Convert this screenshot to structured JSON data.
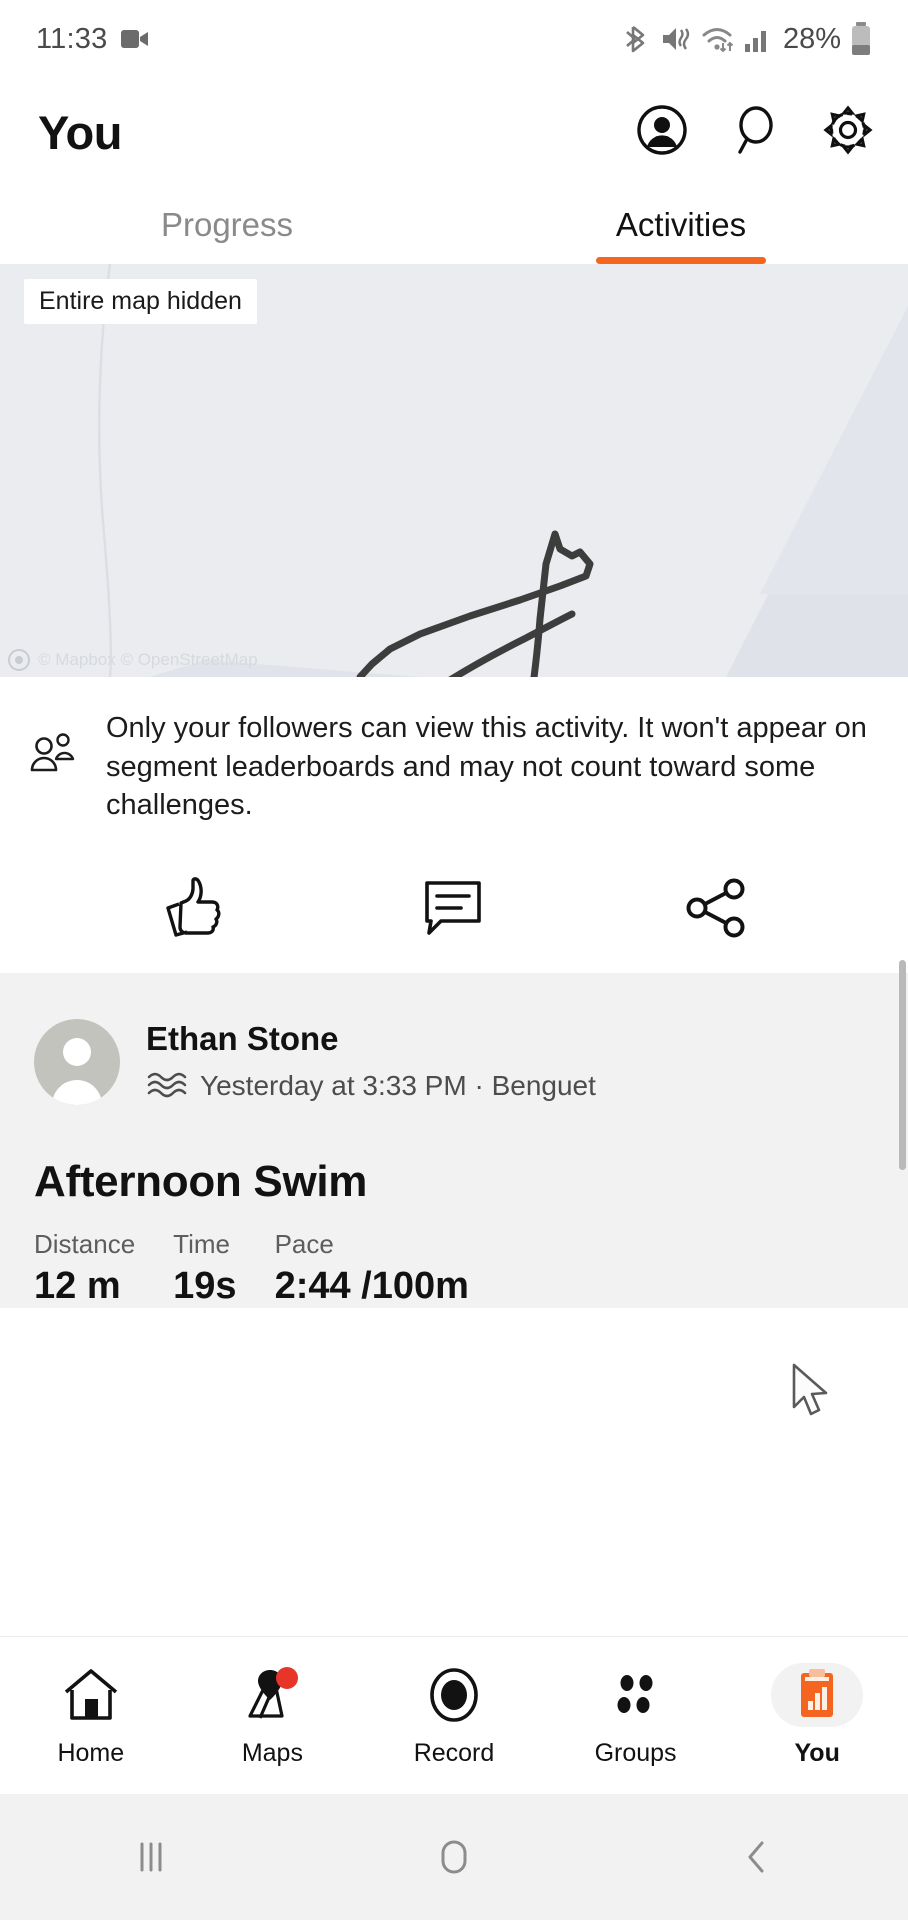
{
  "status_bar": {
    "time": "11:33",
    "battery_percent": "28%",
    "icons": [
      "video-recording-icon",
      "bluetooth-icon",
      "mute-vibrate-icon",
      "wifi-icon",
      "cellular-signal-icon",
      "battery-icon"
    ]
  },
  "header": {
    "title": "You",
    "actions": [
      {
        "name": "account-icon",
        "label": "Account"
      },
      {
        "name": "search-icon",
        "label": "Search"
      },
      {
        "name": "settings-gear-icon",
        "label": "Settings"
      }
    ]
  },
  "tabs": [
    {
      "label": "Progress",
      "active": false
    },
    {
      "label": "Activities",
      "active": true
    }
  ],
  "map": {
    "badge": "Entire map hidden",
    "attribution": "© Mapbox © OpenStreetMap",
    "accent_color": "#f4661f",
    "route_color": "#3d3d3d",
    "background_color": "#eaecf0"
  },
  "privacy_notice": {
    "icon": "followers-group-icon",
    "text": "Only your followers can view this activity. It won't appear on segment leaderboards and may not count toward some challenges."
  },
  "activity_actions": [
    {
      "name": "like-thumbs-up-icon",
      "label": "Like"
    },
    {
      "name": "comment-bubble-icon",
      "label": "Comment"
    },
    {
      "name": "share-icon",
      "label": "Share"
    }
  ],
  "activity": {
    "athlete_name": "Ethan Stone",
    "sport_icon": "swim-waves-icon",
    "subtitle": "Yesterday at 3:33 PM · Benguet",
    "title": "Afternoon Swim",
    "stats": [
      {
        "label": "Distance",
        "value": "12 m"
      },
      {
        "label": "Time",
        "value": "19s"
      },
      {
        "label": "Pace",
        "value": "2:44 /100m"
      }
    ]
  },
  "bottom_nav": [
    {
      "label": "Home",
      "icon": "home-icon",
      "active": false,
      "badge": false
    },
    {
      "label": "Maps",
      "icon": "map-pin-icon",
      "active": false,
      "badge": true
    },
    {
      "label": "Record",
      "icon": "record-circle-icon",
      "active": false,
      "badge": false
    },
    {
      "label": "Groups",
      "icon": "groups-dots-icon",
      "active": false,
      "badge": false
    },
    {
      "label": "You",
      "icon": "clipboard-chart-icon",
      "active": true,
      "badge": false
    }
  ],
  "system_nav": [
    {
      "name": "recents-button",
      "label": "Recents"
    },
    {
      "name": "home-button",
      "label": "Home"
    },
    {
      "name": "back-button",
      "label": "Back"
    }
  ]
}
